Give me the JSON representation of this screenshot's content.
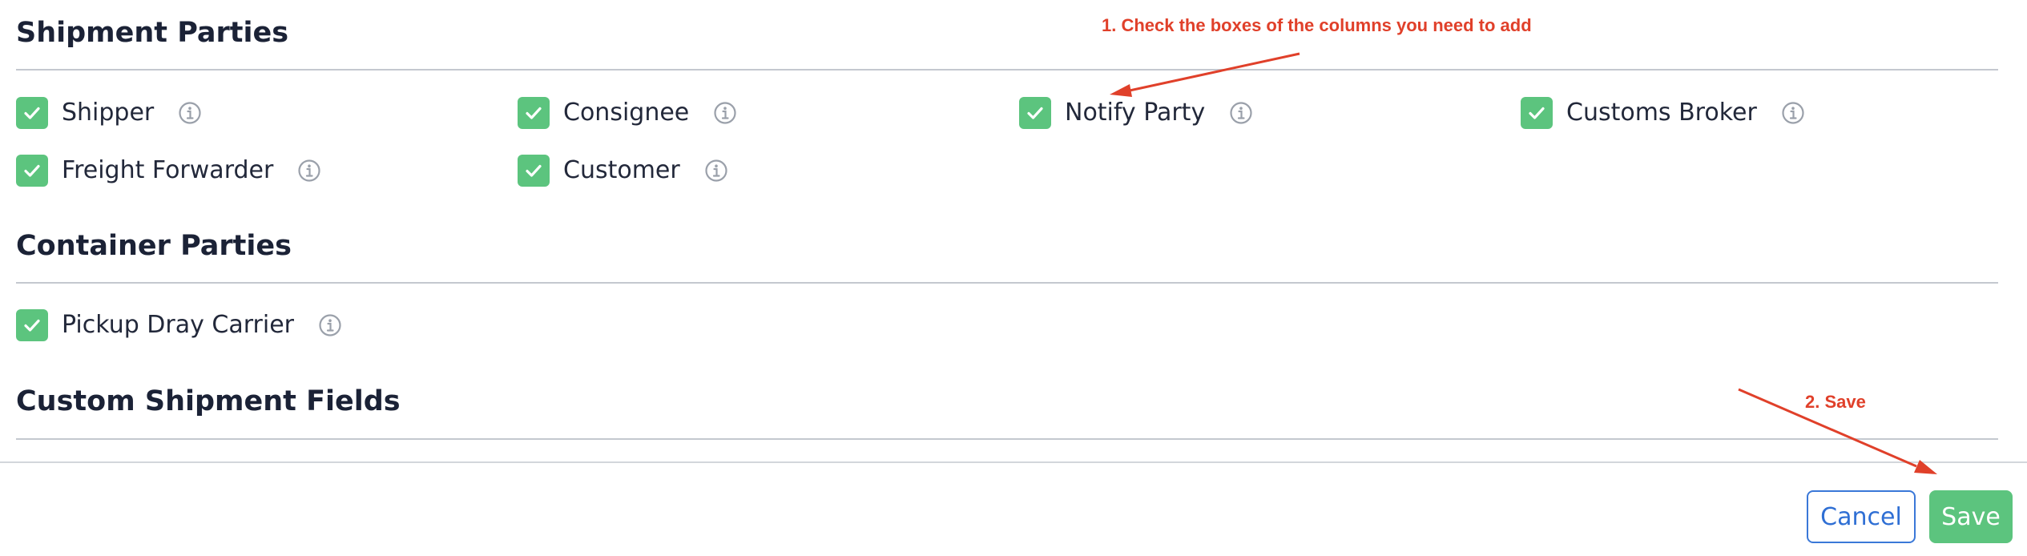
{
  "sections": {
    "shipment_parties": {
      "title": "Shipment Parties",
      "items": [
        {
          "label": "Shipper",
          "checked": true
        },
        {
          "label": "Consignee",
          "checked": true
        },
        {
          "label": "Notify Party",
          "checked": true
        },
        {
          "label": "Customs Broker",
          "checked": true
        },
        {
          "label": "Freight Forwarder",
          "checked": true
        },
        {
          "label": "Customer",
          "checked": true
        }
      ]
    },
    "container_parties": {
      "title": "Container Parties",
      "items": [
        {
          "label": "Pickup Dray Carrier",
          "checked": true
        }
      ]
    },
    "custom_shipment_fields": {
      "title": "Custom Shipment Fields"
    }
  },
  "footer": {
    "cancel_label": "Cancel",
    "save_label": "Save"
  },
  "annotations": {
    "step1": "1. Check the boxes of the columns you need to add",
    "step2": "2. Save"
  },
  "icons": {
    "checkbox": "check-icon",
    "info": "info-icon"
  },
  "colors": {
    "check_green": "#5cc47e",
    "link_blue": "#2f6fd4",
    "annotation_red": "#e0402a",
    "info_gray": "#9aa0aa"
  }
}
